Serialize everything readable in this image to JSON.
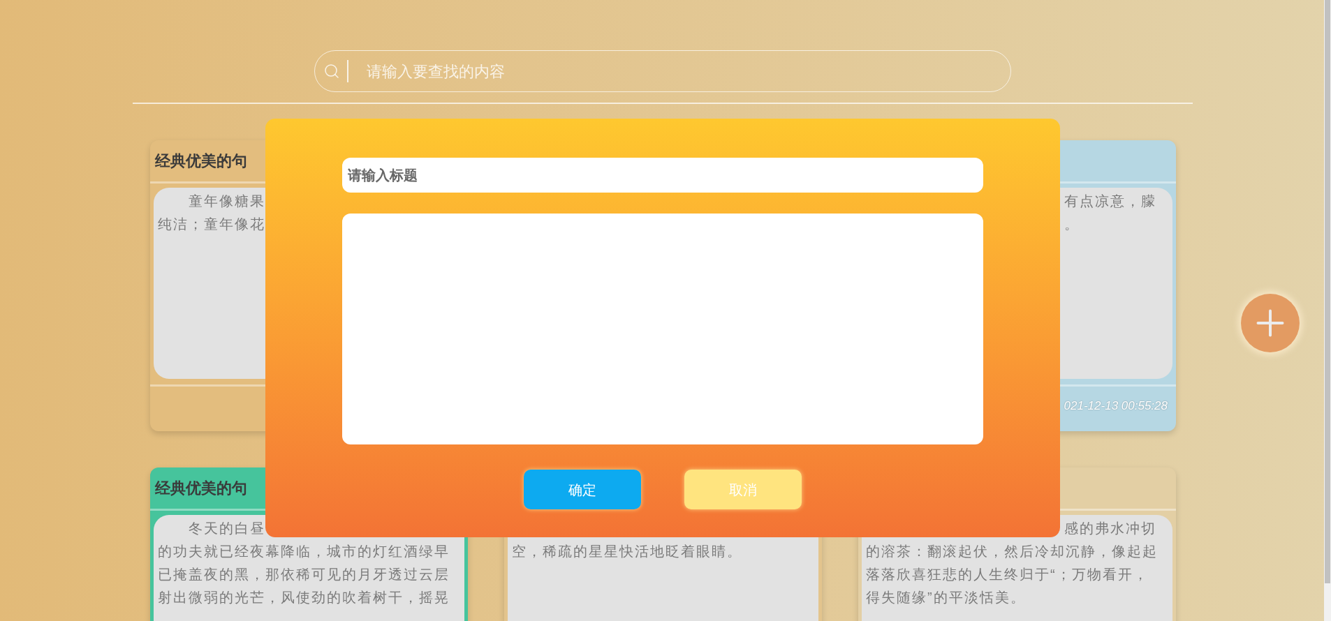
{
  "search": {
    "placeholder": "请输入要查找的内容"
  },
  "cards": [
    {
      "kind": "note",
      "color": "#e3bd7e",
      "title": "经典优美的句",
      "lines": [
        {
          "kind": "indent",
          "text": "童年像糖果"
        },
        {
          "kind": "plain",
          "text": "纯洁；童年像花"
        }
      ]
    },
    {
      "kind": "covered"
    },
    {
      "kind": "note",
      "color": "#b6d7e3",
      "lines": [
        {
          "kind": "tail",
          "text": "有点凉意，朦"
        },
        {
          "kind": "tail",
          "text": "。"
        }
      ],
      "date": "021-12-13 00:55:28"
    },
    {
      "kind": "note",
      "color": "#46c49c",
      "title": "经典优美的句",
      "lines": [
        {
          "kind": "indent",
          "text": "冬天的白昼"
        },
        {
          "kind": "plain",
          "text": "的功夫就已经夜幕降临，城市的灯红酒绿早"
        },
        {
          "kind": "plain",
          "text": "已掩盖夜的黑，那依稀可见的月牙透过云层"
        },
        {
          "kind": "plain",
          "text": "射出微弱的光芒，风使劲的吹着树干，摇晃"
        }
      ]
    },
    {
      "kind": "note",
      "color": "#e3c48d",
      "lines": [
        {
          "kind": "covered"
        },
        {
          "kind": "plain",
          "text": "空，稀疏的星星快活地眨着眼睛。"
        }
      ]
    },
    {
      "kind": "note",
      "color": "#e3cfa4",
      "lines": [
        {
          "kind": "tail",
          "text": "感的弗水冲切"
        },
        {
          "kind": "plain",
          "text": "的溶茶：翻滚起伏，然后冷却沉静，像起起"
        },
        {
          "kind": "plain",
          "text": "落落欣喜狂悲的人生终归于“；万物看开，"
        },
        {
          "kind": "plain",
          "text": "得失随缘”的平淡恬美。"
        }
      ]
    }
  ],
  "dialog": {
    "title_field": {
      "placeholder": "请输入标题"
    },
    "buttons": [
      {
        "kind": "confirm",
        "label": "确定"
      },
      {
        "kind": "cancel",
        "label": "取消"
      }
    ]
  }
}
